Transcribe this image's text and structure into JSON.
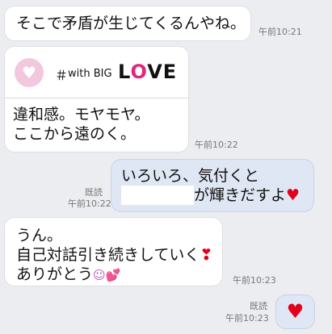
{
  "messages": [
    {
      "id": "m1",
      "direction": "in",
      "text": "そこで矛盾が生じてくるんやね。",
      "time": "午前10:21"
    },
    {
      "id": "m2",
      "direction": "in",
      "card": {
        "hashtag": "＃",
        "with": "with BIG",
        "love_l": "L",
        "love_o": "O",
        "love_ve": "VE",
        "icon": "heart-icon"
      },
      "lines": [
        "違和感。モヤモヤ。",
        "ここから遠のく。"
      ],
      "time": "午前10:22"
    },
    {
      "id": "m3",
      "direction": "out",
      "line1": "いろいろ、気付くと",
      "line2_suffix": "が輝きだすよ",
      "emoji": "♥",
      "read": "既読",
      "time": "午前10:22"
    },
    {
      "id": "m4",
      "direction": "in",
      "lines": [
        "うん。",
        "自己対話引き続きしていく",
        "ありがとう"
      ],
      "emoji_exclaim": "❣",
      "emoji_smile": "☺",
      "emoji_hearts": "💕",
      "time": "午前10:23"
    },
    {
      "id": "m5",
      "direction": "out",
      "emoji": "♥",
      "read": "既読",
      "time": "午前10:23"
    }
  ],
  "colors": {
    "background": "#ecedf0",
    "outgoing": "#dfe6f4",
    "incoming": "#ffffff",
    "heart": "#e2001a",
    "love_accent": "#e0287a"
  }
}
